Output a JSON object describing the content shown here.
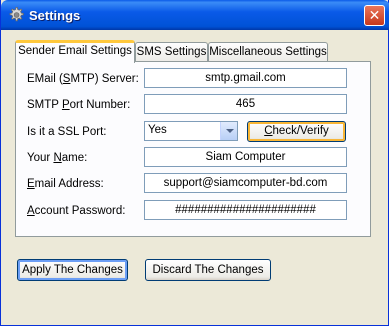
{
  "window": {
    "title": "Settings",
    "icon": "gear-icon",
    "close_label": "✕"
  },
  "tabs": [
    {
      "label": "Sender Email Settings",
      "active": true
    },
    {
      "label": "SMS Settings",
      "active": false
    },
    {
      "label": "Miscellaneous Settings",
      "active": false
    }
  ],
  "fields": {
    "smtp_server": {
      "label_pre": "EMail (",
      "label_u": "S",
      "label_post": "MTP) Server:",
      "value": "smtp.gmail.com"
    },
    "smtp_port": {
      "label_pre": "SMTP ",
      "label_u": "P",
      "label_post": "ort Number:",
      "value": "465"
    },
    "ssl_port": {
      "label": "Is it a SSL Port:",
      "value": "Yes"
    },
    "your_name": {
      "label_pre": "Your ",
      "label_u": "N",
      "label_post": "ame:",
      "value": "Siam Computer"
    },
    "email_address": {
      "label_pre": "",
      "label_u": "E",
      "label_post": "mail Address:",
      "value": "support@siamcomputer-bd.com"
    },
    "account_password": {
      "label_pre": "",
      "label_u": "A",
      "label_post": "ccount Password:",
      "value": "######################"
    }
  },
  "buttons": {
    "check_verify": {
      "label_u": "C",
      "label_post": "heck/Verify"
    },
    "apply": {
      "label": "Apply The Changes"
    },
    "discard": {
      "label": "Discard The Changes"
    }
  },
  "colors": {
    "titlebar": "#0a5ae8",
    "tab_highlight": "#ffc83c",
    "face": "#ece9d8"
  }
}
